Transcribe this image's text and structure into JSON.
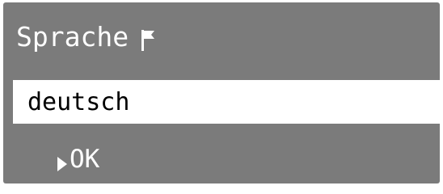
{
  "header": {
    "title": "Sprache",
    "title_icon": "flag-icon"
  },
  "field": {
    "value": "deutsch"
  },
  "action": {
    "label": "OK",
    "icon": "play-arrow-icon"
  },
  "colors": {
    "panel_background": "#7b7b7b",
    "text_light": "#ffffff",
    "field_background": "#ffffff",
    "field_text": "#000000"
  }
}
